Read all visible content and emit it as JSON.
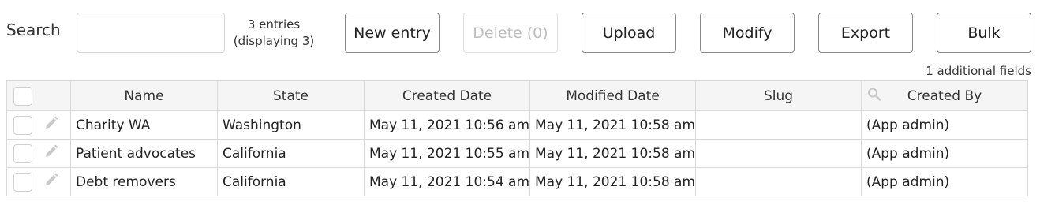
{
  "toolbar": {
    "search_label": "Search",
    "search_value": "",
    "count_line1": "3 entries",
    "count_line2": "(displaying 3)",
    "new_entry": "New entry",
    "delete": "Delete (0)",
    "upload": "Upload",
    "modify": "Modify",
    "export": "Export",
    "bulk": "Bulk",
    "additional_fields": "1 additional fields"
  },
  "table": {
    "columns": [
      "Name",
      "State",
      "Created Date",
      "Modified Date",
      "Slug",
      "Created By"
    ],
    "rows": [
      {
        "name": "Charity WA",
        "state": "Washington",
        "created": "May 11, 2021 10:56 am",
        "modified": "May 11, 2021 10:58 am",
        "slug": "",
        "created_by": "(App admin)"
      },
      {
        "name": "Patient advocates",
        "state": "California",
        "created": "May 11, 2021 10:55 am",
        "modified": "May 11, 2021 10:58 am",
        "slug": "",
        "created_by": "(App admin)"
      },
      {
        "name": "Debt removers",
        "state": "California",
        "created": "May 11, 2021 10:54 am",
        "modified": "May 11, 2021 10:58 am",
        "slug": "",
        "created_by": "(App admin)"
      }
    ]
  },
  "icons": {
    "edit": "pencil-icon",
    "column_search": "search-icon"
  },
  "colors": {
    "header_bg": "#f5f5f5",
    "border": "#d9d9d9",
    "disabled_text": "#bdbdbd",
    "icon_gray": "#c8c8c8"
  }
}
